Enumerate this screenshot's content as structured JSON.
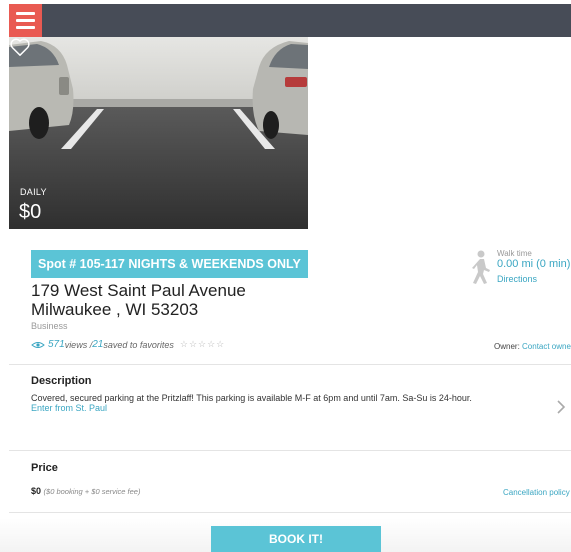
{
  "header": {
    "menu_icon": "hamburger-menu-icon",
    "menu_color": "#e95a52",
    "bar_color": "#474c57"
  },
  "listing": {
    "photo_icon": "parking-lot-photo",
    "rate_label": "DAILY",
    "rate_price": "$0",
    "favorite_icon": "heart-outline-icon",
    "spot_badge": "Spot # 105-117 NIGHTS & WEEKENDS ONLY",
    "address_line1": "179 West Saint Paul Avenue",
    "address_line2": "Milwaukee , WI 53203",
    "category": "Business",
    "views_count": "571",
    "views_label": " views / ",
    "saved_count": "21",
    "saved_label": " saved to favorites",
    "stars": "☆☆☆☆☆",
    "rating_stars": 0,
    "owner_label": "Owner: ",
    "owner_link": "Contact owner",
    "accent_color": "#5bc4d6"
  },
  "walk": {
    "icon": "walking-person-icon",
    "label": "Walk time",
    "value": "0.00 mi (0 min)",
    "link": "Directions"
  },
  "description": {
    "title": "Description",
    "text": "Covered, secured parking at the Pritzlaff! This parking is available M-F at 6pm and until 7am. Sa-Su is 24-hour.",
    "link": "Enter from St. Paul",
    "chevron_icon": "chevron-right-icon"
  },
  "price": {
    "title": "Price",
    "amount": "$0",
    "breakdown": "($0 booking + $0 service fee)",
    "cancellation_link": "Cancellation policy"
  },
  "cta": {
    "label": "BOOK IT!"
  }
}
